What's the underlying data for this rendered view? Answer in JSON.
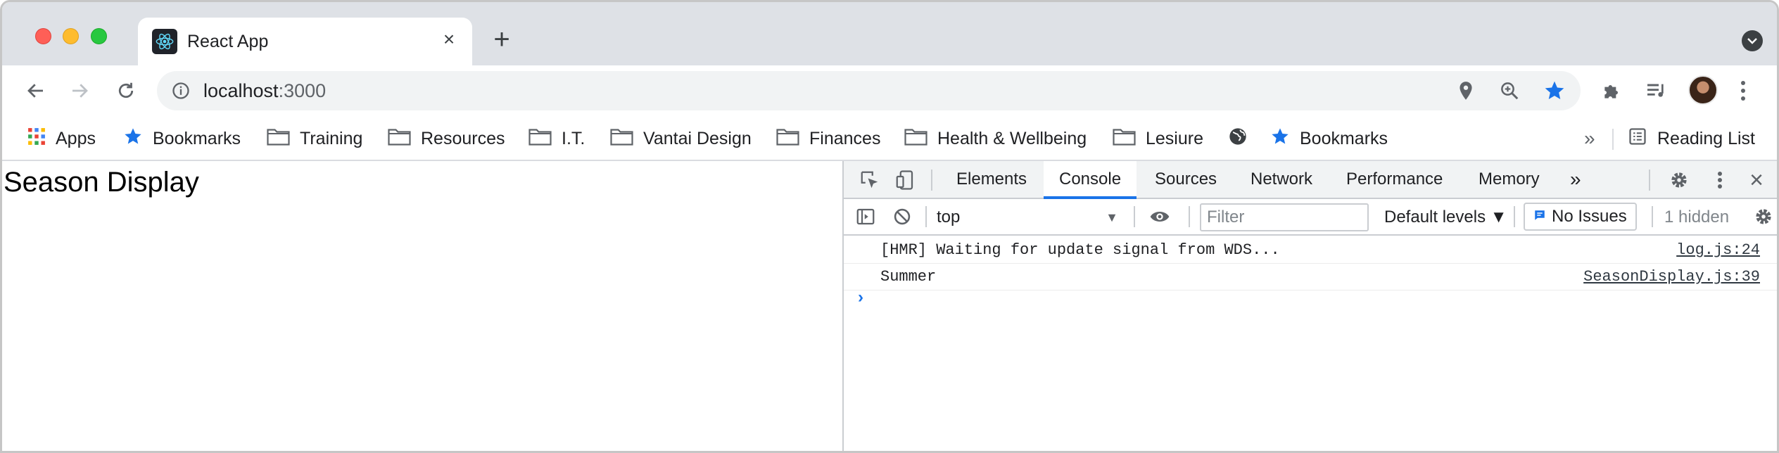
{
  "tab": {
    "title": "React App",
    "close_icon": "×",
    "new_tab_icon": "+"
  },
  "address_bar": {
    "host": "localhost",
    "port": ":3000"
  },
  "bookmarks": {
    "apps": "Apps",
    "items": [
      {
        "label": "Bookmarks",
        "icon": "star-icon"
      },
      {
        "label": "Training",
        "icon": "folder-icon"
      },
      {
        "label": "Resources",
        "icon": "folder-icon"
      },
      {
        "label": "I.T.",
        "icon": "folder-icon"
      },
      {
        "label": "Vantai Design",
        "icon": "folder-icon"
      },
      {
        "label": "Finances",
        "icon": "folder-icon"
      },
      {
        "label": "Health & Wellbeing",
        "icon": "folder-icon"
      },
      {
        "label": "Lesiure",
        "icon": "folder-icon"
      },
      {
        "label": "",
        "icon": "globe-icon"
      },
      {
        "label": "Bookmarks",
        "icon": "star-icon"
      }
    ],
    "overflow": "»",
    "reading_list": "Reading List"
  },
  "page": {
    "heading": "Season Display"
  },
  "devtools": {
    "tabs": [
      "Elements",
      "Console",
      "Sources",
      "Network",
      "Performance",
      "Memory"
    ],
    "active_tab": "Console",
    "more_tabs": "»",
    "close_icon": "×",
    "context": "top",
    "filter_placeholder": "Filter",
    "levels": "Default levels ▼",
    "issues": "No Issues",
    "hidden": "1 hidden",
    "logs": [
      {
        "message": "[HMR] Waiting for update signal from WDS...",
        "source": "log.js:24"
      },
      {
        "message": "Summer",
        "source": "SeasonDisplay.js:39"
      }
    ],
    "prompt": "›"
  },
  "colors": {
    "accent": "#1a73e8",
    "titlebar": "#dee1e6",
    "star": "#1a73e8"
  }
}
